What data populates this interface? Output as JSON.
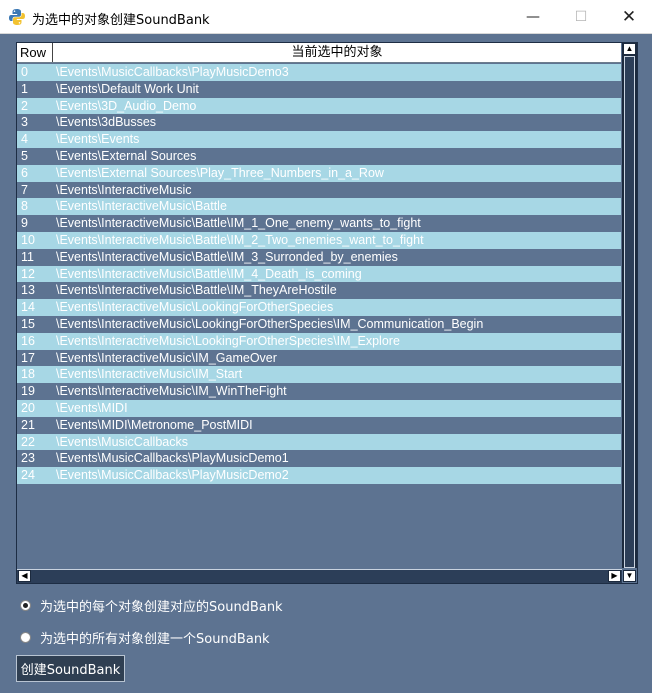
{
  "window": {
    "title": "为选中的对象创建SoundBank",
    "minimize_glyph": "—",
    "maximize_glyph": "☐",
    "close_glyph": "✕",
    "app_icon": "python-icon"
  },
  "table": {
    "headers": {
      "row": "Row",
      "object": "当前选中的对象"
    },
    "rows": [
      {
        "row": "0",
        "object": "\\Events\\MusicCallbacks\\PlayMusicDemo3"
      },
      {
        "row": "1",
        "object": "\\Events\\Default Work Unit"
      },
      {
        "row": "2",
        "object": "\\Events\\3D_Audio_Demo"
      },
      {
        "row": "3",
        "object": "\\Events\\3dBusses"
      },
      {
        "row": "4",
        "object": "\\Events\\Events"
      },
      {
        "row": "5",
        "object": "\\Events\\External Sources"
      },
      {
        "row": "6",
        "object": "\\Events\\External Sources\\Play_Three_Numbers_in_a_Row"
      },
      {
        "row": "7",
        "object": "\\Events\\InteractiveMusic"
      },
      {
        "row": "8",
        "object": "\\Events\\InteractiveMusic\\Battle"
      },
      {
        "row": "9",
        "object": "\\Events\\InteractiveMusic\\Battle\\IM_1_One_enemy_wants_to_fight"
      },
      {
        "row": "10",
        "object": "\\Events\\InteractiveMusic\\Battle\\IM_2_Two_enemies_want_to_fight"
      },
      {
        "row": "11",
        "object": "\\Events\\InteractiveMusic\\Battle\\IM_3_Surronded_by_enemies"
      },
      {
        "row": "12",
        "object": "\\Events\\InteractiveMusic\\Battle\\IM_4_Death_is_coming"
      },
      {
        "row": "13",
        "object": "\\Events\\InteractiveMusic\\Battle\\IM_TheyAreHostile"
      },
      {
        "row": "14",
        "object": "\\Events\\InteractiveMusic\\LookingForOtherSpecies"
      },
      {
        "row": "15",
        "object": "\\Events\\InteractiveMusic\\LookingForOtherSpecies\\IM_Communication_Begin"
      },
      {
        "row": "16",
        "object": "\\Events\\InteractiveMusic\\LookingForOtherSpecies\\IM_Explore"
      },
      {
        "row": "17",
        "object": "\\Events\\InteractiveMusic\\IM_GameOver"
      },
      {
        "row": "18",
        "object": "\\Events\\InteractiveMusic\\IM_Start"
      },
      {
        "row": "19",
        "object": "\\Events\\InteractiveMusic\\IM_WinTheFight"
      },
      {
        "row": "20",
        "object": "\\Events\\MIDI"
      },
      {
        "row": "21",
        "object": "\\Events\\MIDI\\Metronome_PostMIDI"
      },
      {
        "row": "22",
        "object": "\\Events\\MusicCallbacks"
      },
      {
        "row": "23",
        "object": "\\Events\\MusicCallbacks\\PlayMusicDemo1"
      },
      {
        "row": "24",
        "object": "\\Events\\MusicCallbacks\\PlayMusicDemo2"
      }
    ]
  },
  "options": {
    "each_label": "为选中的每个对象创建对应的SoundBank",
    "all_label": "为选中的所有对象创建一个SoundBank",
    "selected": "each"
  },
  "actions": {
    "create_label": "创建SoundBank"
  },
  "colors": {
    "background": "#5d7391",
    "row_alt": "#a7d7e5",
    "button": "#2f3f52"
  }
}
